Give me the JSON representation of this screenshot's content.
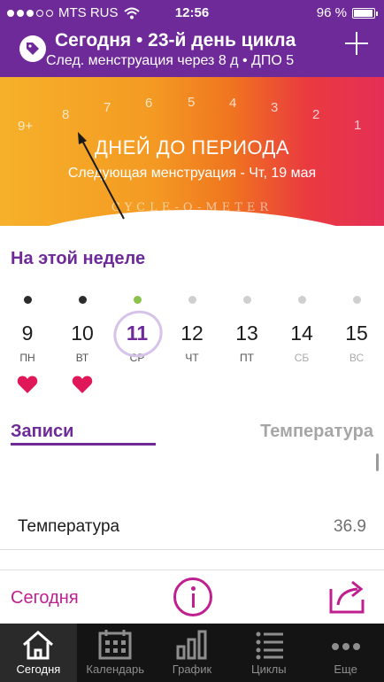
{
  "status_bar": {
    "carrier": "MTS RUS",
    "time": "12:56",
    "battery": "96 %"
  },
  "header": {
    "title": "Сегодня • 23-й день цикла",
    "subtitle": "След. менструация через 8 д • ДПО 5"
  },
  "meter": {
    "scale": [
      "9+",
      "8",
      "7",
      "6",
      "5",
      "4",
      "3",
      "2",
      "1"
    ],
    "headline": "ДНЕЙ ДО ПЕРИОДА",
    "next_period": "Следующая менструация - Чт, 19 мая",
    "brand": "CYCLE-O-METER"
  },
  "week": {
    "title": "На этой неделе",
    "days": [
      {
        "date": "9",
        "weekday": "ПН",
        "heart": true,
        "dot": "filled"
      },
      {
        "date": "10",
        "weekday": "ВТ",
        "heart": true,
        "dot": "filled"
      },
      {
        "date": "11",
        "weekday": "СР",
        "heart": false,
        "dot": "today"
      },
      {
        "date": "12",
        "weekday": "ЧТ",
        "heart": false,
        "dot": "empty"
      },
      {
        "date": "13",
        "weekday": "ПТ",
        "heart": false,
        "dot": "empty"
      },
      {
        "date": "14",
        "weekday": "СБ",
        "heart": false,
        "dot": "empty"
      },
      {
        "date": "15",
        "weekday": "ВС",
        "heart": false,
        "dot": "empty"
      }
    ]
  },
  "tabs": {
    "records": "Записи",
    "temperature": "Температура"
  },
  "records": [
    {
      "label": "Температура",
      "value": "36.9"
    }
  ],
  "actions": {
    "today": "Сегодня"
  },
  "tabbar": [
    {
      "label": "Сегодня",
      "icon": "home-icon",
      "active": true
    },
    {
      "label": "Календарь",
      "icon": "calendar-icon",
      "active": false
    },
    {
      "label": "График",
      "icon": "chart-icon",
      "active": false
    },
    {
      "label": "Циклы",
      "icon": "list-icon",
      "active": false
    },
    {
      "label": "Еще",
      "icon": "more-icon",
      "active": false
    }
  ],
  "colors": {
    "brand": "#6f2a9a",
    "accent": "#c0208f",
    "heart": "#e0185a",
    "today_dot": "#8bc34a"
  }
}
